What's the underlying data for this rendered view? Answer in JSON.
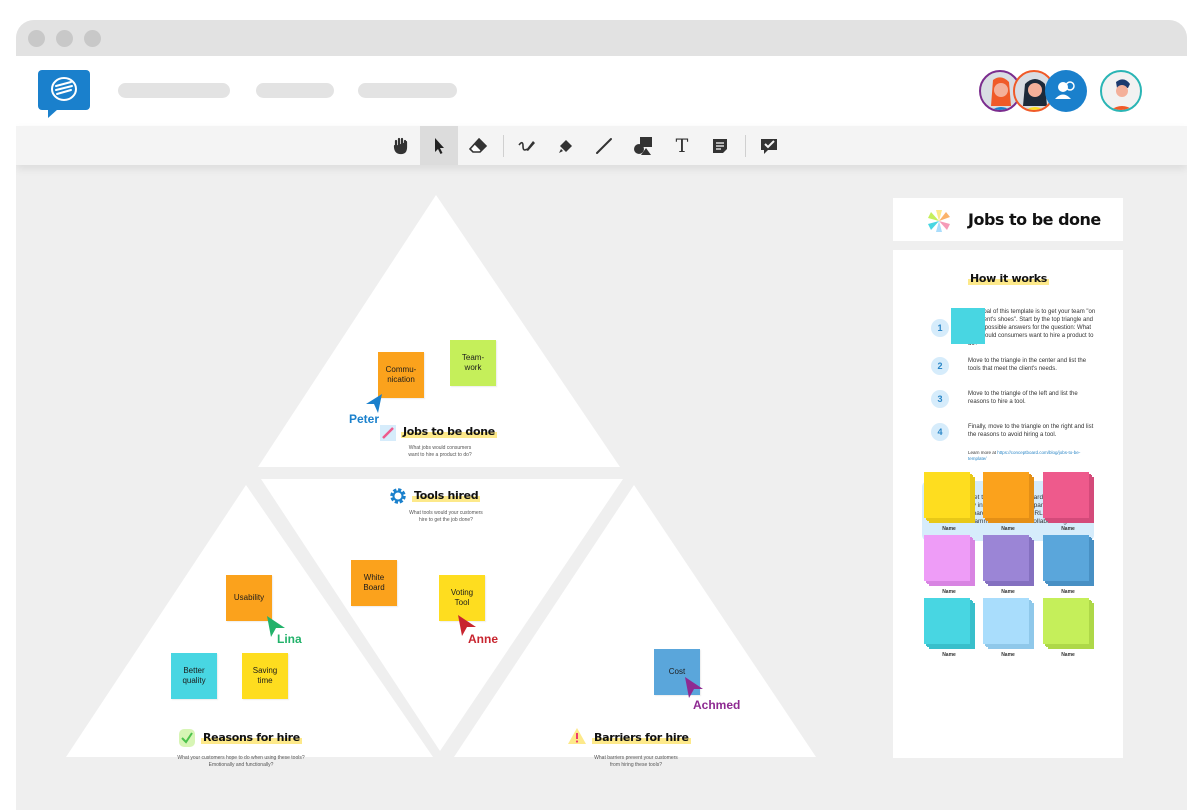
{
  "window": {
    "title_dots": [
      "close",
      "minimize",
      "maximize"
    ]
  },
  "appbar": {
    "logo_icon": "conceptboard-logo-icon",
    "nav_placeholders": [
      "",
      "",
      ""
    ],
    "avatars": [
      {
        "name": "avatar-red-hair-woman",
        "ring": "#7b2d8e"
      },
      {
        "name": "avatar-dark-hair-woman",
        "ring": "#f05a28"
      },
      {
        "name": "participants-icon",
        "ring": "#1a80cc"
      },
      {
        "name": "avatar-man",
        "ring": "#2ab5b5"
      }
    ]
  },
  "toolbar": {
    "tools": [
      {
        "name": "hand-tool",
        "icon": "hand-icon"
      },
      {
        "name": "select-tool",
        "icon": "pointer-icon",
        "active": true
      },
      {
        "name": "eraser-tool",
        "icon": "eraser-icon"
      },
      {
        "name": "pen-tool",
        "icon": "pen-icon"
      },
      {
        "name": "highlighter-tool",
        "icon": "highlighter-icon"
      },
      {
        "name": "line-tool",
        "icon": "line-icon"
      },
      {
        "name": "shapes-tool",
        "icon": "shapes-icon"
      },
      {
        "name": "text-tool",
        "icon": "text-icon",
        "label": "T"
      },
      {
        "name": "sticky-note-tool",
        "icon": "sticky-note-icon"
      },
      {
        "name": "review-tool",
        "icon": "comment-check-icon"
      }
    ]
  },
  "board": {
    "sections": {
      "jobs": {
        "title": "Jobs to be done",
        "subtitle_l1": "What jobs would consumers",
        "subtitle_l2": "want to hire a product to do?",
        "icon": "pencil-icon"
      },
      "tools": {
        "title": "Tools hired",
        "subtitle_l1": "What tools would your customers",
        "subtitle_l2": "hire to get the job done?",
        "icon": "gear-icon"
      },
      "reasons": {
        "title": "Reasons for hire",
        "subtitle_l1": "What your customers hope to do when using these tools?",
        "subtitle_l2": "Emotionally and functionally?",
        "icon": "checkmark-icon"
      },
      "barriers": {
        "title": "Barriers for hire",
        "subtitle_l1": "What barriers prevent your customers",
        "subtitle_l2": "from hiring these tools?",
        "icon": "warning-icon"
      }
    },
    "stickies": [
      {
        "text_l1": "Commu-",
        "text_l2": "nication",
        "color": "#fba21c"
      },
      {
        "text_l1": "Team-",
        "text_l2": "work",
        "color": "#c5ef5a"
      },
      {
        "text_l1": "White",
        "text_l2": "Board",
        "color": "#fba21c"
      },
      {
        "text_l1": "Voting",
        "text_l2": "Tool",
        "color": "#fedd1f"
      },
      {
        "text_l1": "Usability",
        "text_l2": "",
        "color": "#fba21c"
      },
      {
        "text_l1": "Better",
        "text_l2": "quality",
        "color": "#48d6e2"
      },
      {
        "text_l1": "Saving",
        "text_l2": "time",
        "color": "#fedd1f"
      },
      {
        "text_l1": "Cost",
        "text_l2": "",
        "color": "#5aa6db"
      }
    ],
    "cursors": [
      {
        "name": "Peter",
        "color": "#1a80cc"
      },
      {
        "name": "Anne",
        "color": "#c8252f"
      },
      {
        "name": "Lina",
        "color": "#22b26a"
      },
      {
        "name": "Achmed",
        "color": "#8e2a92"
      }
    ]
  },
  "instructions": {
    "title": "Jobs to be done",
    "how_title": "How it works",
    "steps": [
      {
        "num": "1",
        "text": "The goal of this template is to get your team \"on the client's shoes\". Start by the top triangle and list all possible answers for the question: What jobs would consumers want to hire a product to do?"
      },
      {
        "num": "2",
        "text": "Move to the triangle in the center and list the tools that meet the client's needs."
      },
      {
        "num": "3",
        "text": "Move to the triangle of the left and list the reasons to hire a tool."
      },
      {
        "num": "4",
        "text": "Finally, move to the triangle on the right and list the reasons to avoid hiring a tool."
      }
    ],
    "learn_more_prefix": "Learn more at ",
    "learn_more_link": "https://conceptboard.com/blog/jobs-to-be-template/",
    "promo_text": "Get the full Conceptboard experience by inviting more participants to your board. Just send the URL to your teammates and start collaborating!",
    "sticky_palette": [
      {
        "label": "Name",
        "color": "#fedd1f",
        "shade": "#e8c817"
      },
      {
        "label": "Name",
        "color": "#fba21c",
        "shade": "#e48f16"
      },
      {
        "label": "Name",
        "color": "#ee5a8c",
        "shade": "#d44a7a"
      },
      {
        "label": "Name",
        "color": "#ee9cf7",
        "shade": "#d884e2"
      },
      {
        "label": "Name",
        "color": "#9b85d6",
        "shade": "#8470c0"
      },
      {
        "label": "Name",
        "color": "#5aa6db",
        "shade": "#4890c4"
      },
      {
        "label": "Name",
        "color": "#48d6e2",
        "shade": "#38bfcb"
      },
      {
        "label": "Name",
        "color": "#a9ddfc",
        "shade": "#8fc8ea"
      },
      {
        "label": "Name",
        "color": "#c5ef5a",
        "shade": "#aed848"
      }
    ]
  }
}
